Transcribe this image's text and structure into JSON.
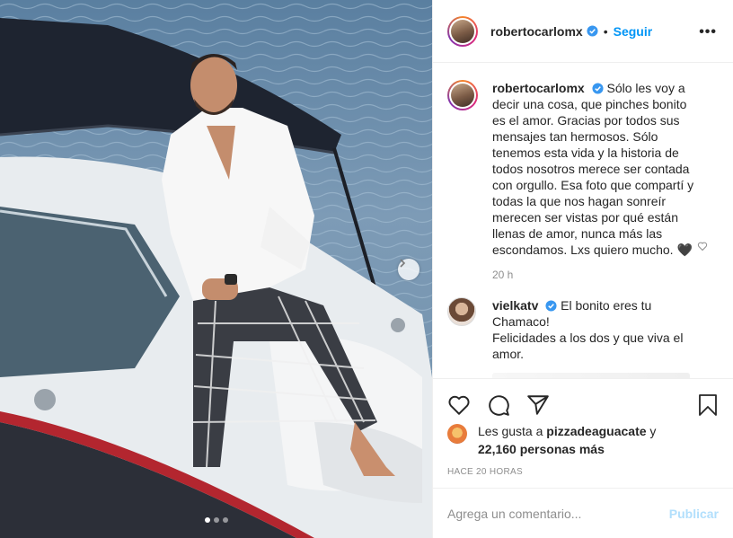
{
  "post": {
    "author": "robertocarlomx",
    "follow_label": "Seguir",
    "separator": "•",
    "more_label": "•••",
    "icons": {
      "verified": "verified-badge-icon",
      "more": "more-options-icon",
      "next": "chevron-right-icon"
    },
    "colors": {
      "accent": "#0095f6",
      "muted": "#8e8e8e",
      "publish_disabled": "#b2dffc"
    }
  },
  "caption": {
    "author": "robertocarlomx",
    "text": "Sólo les voy a decir una cosa, que pinches bonito es el amor. Gracias por todos sus mensajes tan hermosos. Sólo tenemos esta vida y la historia de todos nosotros merece ser contada con orgullo. Esa foto que compartí y todas la que nos hagan sonreír merecen ser vistas por qué están llenas de amor, nunca más las escondamos. Lxs quiero mucho. 🖤",
    "time": "20 h"
  },
  "comments": [
    {
      "author": "vielkatv",
      "text": "El bonito eres tu Chamaco!",
      "text2": "Felicidades a los dos y que viva el amor."
    }
  ],
  "actions": [
    "like-icon",
    "comment-icon",
    "share-icon",
    "save-icon"
  ],
  "likes": {
    "prefix": "Les gusta a ",
    "user": "pizzadeaguacate",
    "suffix": " y",
    "others": "22,160 personas más"
  },
  "time_ago": "HACE 20 HORAS",
  "add_comment": {
    "placeholder": "Agrega un comentario...",
    "publish_label": "Publicar"
  },
  "carousel": {
    "count": 3,
    "active": 1
  }
}
